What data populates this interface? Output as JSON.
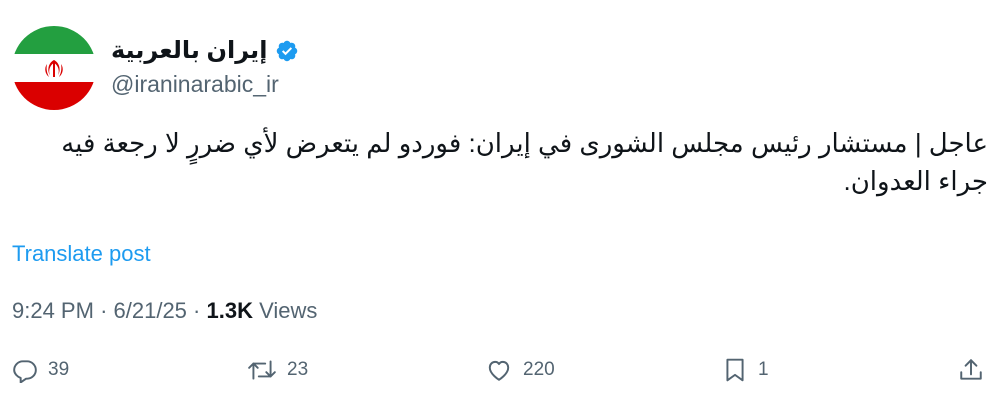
{
  "account": {
    "display_name": "إيران بالعربية",
    "handle": "@iraninarabic_ir",
    "avatar_icon": "iran-flag-icon",
    "verified_icon": "verified-badge-icon",
    "verified_color": "#1d9bf0"
  },
  "tweet": {
    "text": "عاجل | مستشار رئيس مجلس الشورى في إيران: فوردو لم يتعرض لأي ضررٍ لا رجعة فيه جراء العدوان.",
    "translate_label": "Translate post",
    "time": "9:24 PM",
    "date": "6/21/25",
    "separator": "·",
    "views_count": "1.3K",
    "views_label": "Views"
  },
  "actions": {
    "replies": {
      "icon": "reply-icon",
      "count": "39"
    },
    "reposts": {
      "icon": "repost-icon",
      "count": "23"
    },
    "likes": {
      "icon": "heart-icon",
      "count": "220"
    },
    "bookmarks": {
      "icon": "bookmark-icon",
      "count": "1"
    },
    "share": {
      "icon": "share-icon"
    }
  },
  "colors": {
    "link": "#1d9bf0",
    "secondary_text": "#536471",
    "primary_text": "#0f1419",
    "flag_green": "#239f40",
    "flag_red": "#da0000"
  }
}
